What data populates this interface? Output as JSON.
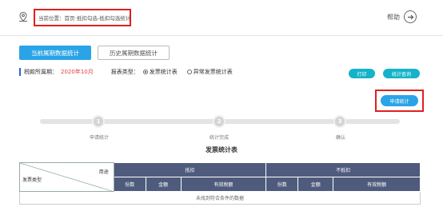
{
  "header": {
    "breadcrumb_label": "当前位置：",
    "breadcrumb_home": "首页",
    "breadcrumb_separator": "-",
    "breadcrumb_path": "抵扣勾选-抵扣勾选统计",
    "help_label": "帮助"
  },
  "tabs": [
    {
      "label": "当前属期数据统计",
      "active": true
    },
    {
      "label": "历史属期数据统计",
      "active": false
    }
  ],
  "period": {
    "label": "税款所属期：",
    "value": "2020年10月",
    "report_type_label": "报表类型：",
    "options": [
      {
        "label": "发票统计表",
        "selected": true
      },
      {
        "label": "异常发票统计表",
        "selected": false
      }
    ]
  },
  "actions": {
    "print_label": "打印",
    "query_label": "统计查询",
    "apply_label": "申请统计"
  },
  "steps": [
    {
      "number": "1",
      "label": "申请统计"
    },
    {
      "number": "2",
      "label": "统计完成"
    },
    {
      "number": "3",
      "label": "确认"
    }
  ],
  "table": {
    "title": "发票统计表",
    "corner_type": "发票类型",
    "corner_use": "用途",
    "group_deduct": "抵扣",
    "group_nondeduct": "不抵扣",
    "columns": [
      "份数",
      "金额",
      "有效税额",
      "份数",
      "金额",
      "有效税额"
    ],
    "empty_message": "未找到符合条件的数据"
  },
  "colors": {
    "accent": "#2aa4e6",
    "teal_button": "#14b3c9",
    "table_header": "#4f5b7d",
    "highlight_box": "#e02020",
    "period_value": "#e04040"
  }
}
